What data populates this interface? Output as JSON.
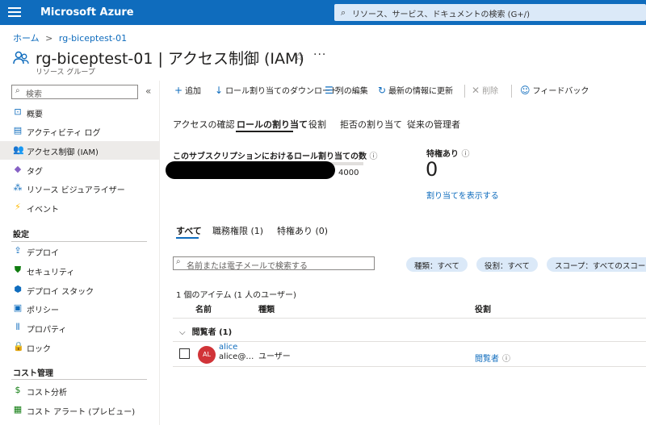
{
  "topbar": {
    "brand": "Microsoft Azure",
    "search_placeholder": "リソース、サービス、ドキュメントの検索 (G+/)",
    "color": "#0f6cbd"
  },
  "breadcrumb": {
    "home": "ホーム",
    "resource_group": "rg-biceptest-01",
    "separator": ">"
  },
  "header": {
    "title": "rg-biceptest-01 | アクセス制御 (IAM)",
    "subtitle": "リソース グループ",
    "star": "☆",
    "more": "···"
  },
  "sidebar": {
    "search_placeholder": "検索",
    "collapse": "«",
    "items": [
      {
        "label": "概要",
        "icon": "overview-icon"
      },
      {
        "label": "アクティビティ ログ",
        "icon": "activity-log-icon"
      },
      {
        "label": "アクセス制御 (IAM)",
        "icon": "iam-icon"
      },
      {
        "label": "タグ",
        "icon": "tag-icon"
      },
      {
        "label": "リソース ビジュアライザー",
        "icon": "visualizer-icon"
      },
      {
        "label": "イベント",
        "icon": "event-icon"
      }
    ],
    "section_settings": "設定",
    "settings_items": [
      {
        "label": "デプロイ",
        "icon": "deploy-icon"
      },
      {
        "label": "セキュリティ",
        "icon": "security-icon"
      },
      {
        "label": "デプロイ スタック",
        "icon": "deploy-stack-icon"
      },
      {
        "label": "ポリシー",
        "icon": "policy-icon"
      },
      {
        "label": "プロパティ",
        "icon": "properties-icon"
      },
      {
        "label": "ロック",
        "icon": "lock-icon"
      }
    ],
    "section_cost": "コスト管理",
    "cost_items": [
      {
        "label": "コスト分析",
        "icon": "cost-analysis-icon"
      },
      {
        "label": "コスト アラート (プレビュー)",
        "icon": "cost-alert-icon"
      }
    ]
  },
  "toolbar": {
    "add": "追加",
    "download": "ロール割り当てのダウンロード",
    "columns": "列の編集",
    "refresh": "最新の情報に更新",
    "delete": "削除",
    "feedback": "フィードバック"
  },
  "tabs": [
    "アクセスの確認",
    "ロールの割り当て",
    "役割",
    "拒否の割り当て",
    "従来の管理者"
  ],
  "active_tab": "ロールの割り当て",
  "assignment_count": {
    "title": "このサブスクリプションにおけるロール割り当ての数",
    "max": "4000",
    "used_fraction": 0.02
  },
  "privileged": {
    "title": "特権あり",
    "count": "0",
    "link": "割り当てを表示する"
  },
  "subtabs": [
    "すべて",
    "職務権限 (1)",
    "特権あり (0)"
  ],
  "filter": {
    "placeholder": "名前または電子メールで検索する",
    "type": "種類：すべて",
    "role": "役割：すべて",
    "scope": "スコープ：すべてのスコープ"
  },
  "table": {
    "count_text": "1 個のアイテム (1 人のユーザー)",
    "headers": {
      "name": "名前",
      "type": "種類",
      "role": "役割"
    },
    "group": "閲覧者 (1)",
    "rows": [
      {
        "initials": "AL",
        "name": "alice",
        "email": "alice@…",
        "type": "ユーザー",
        "role": "閲覧者"
      }
    ]
  }
}
